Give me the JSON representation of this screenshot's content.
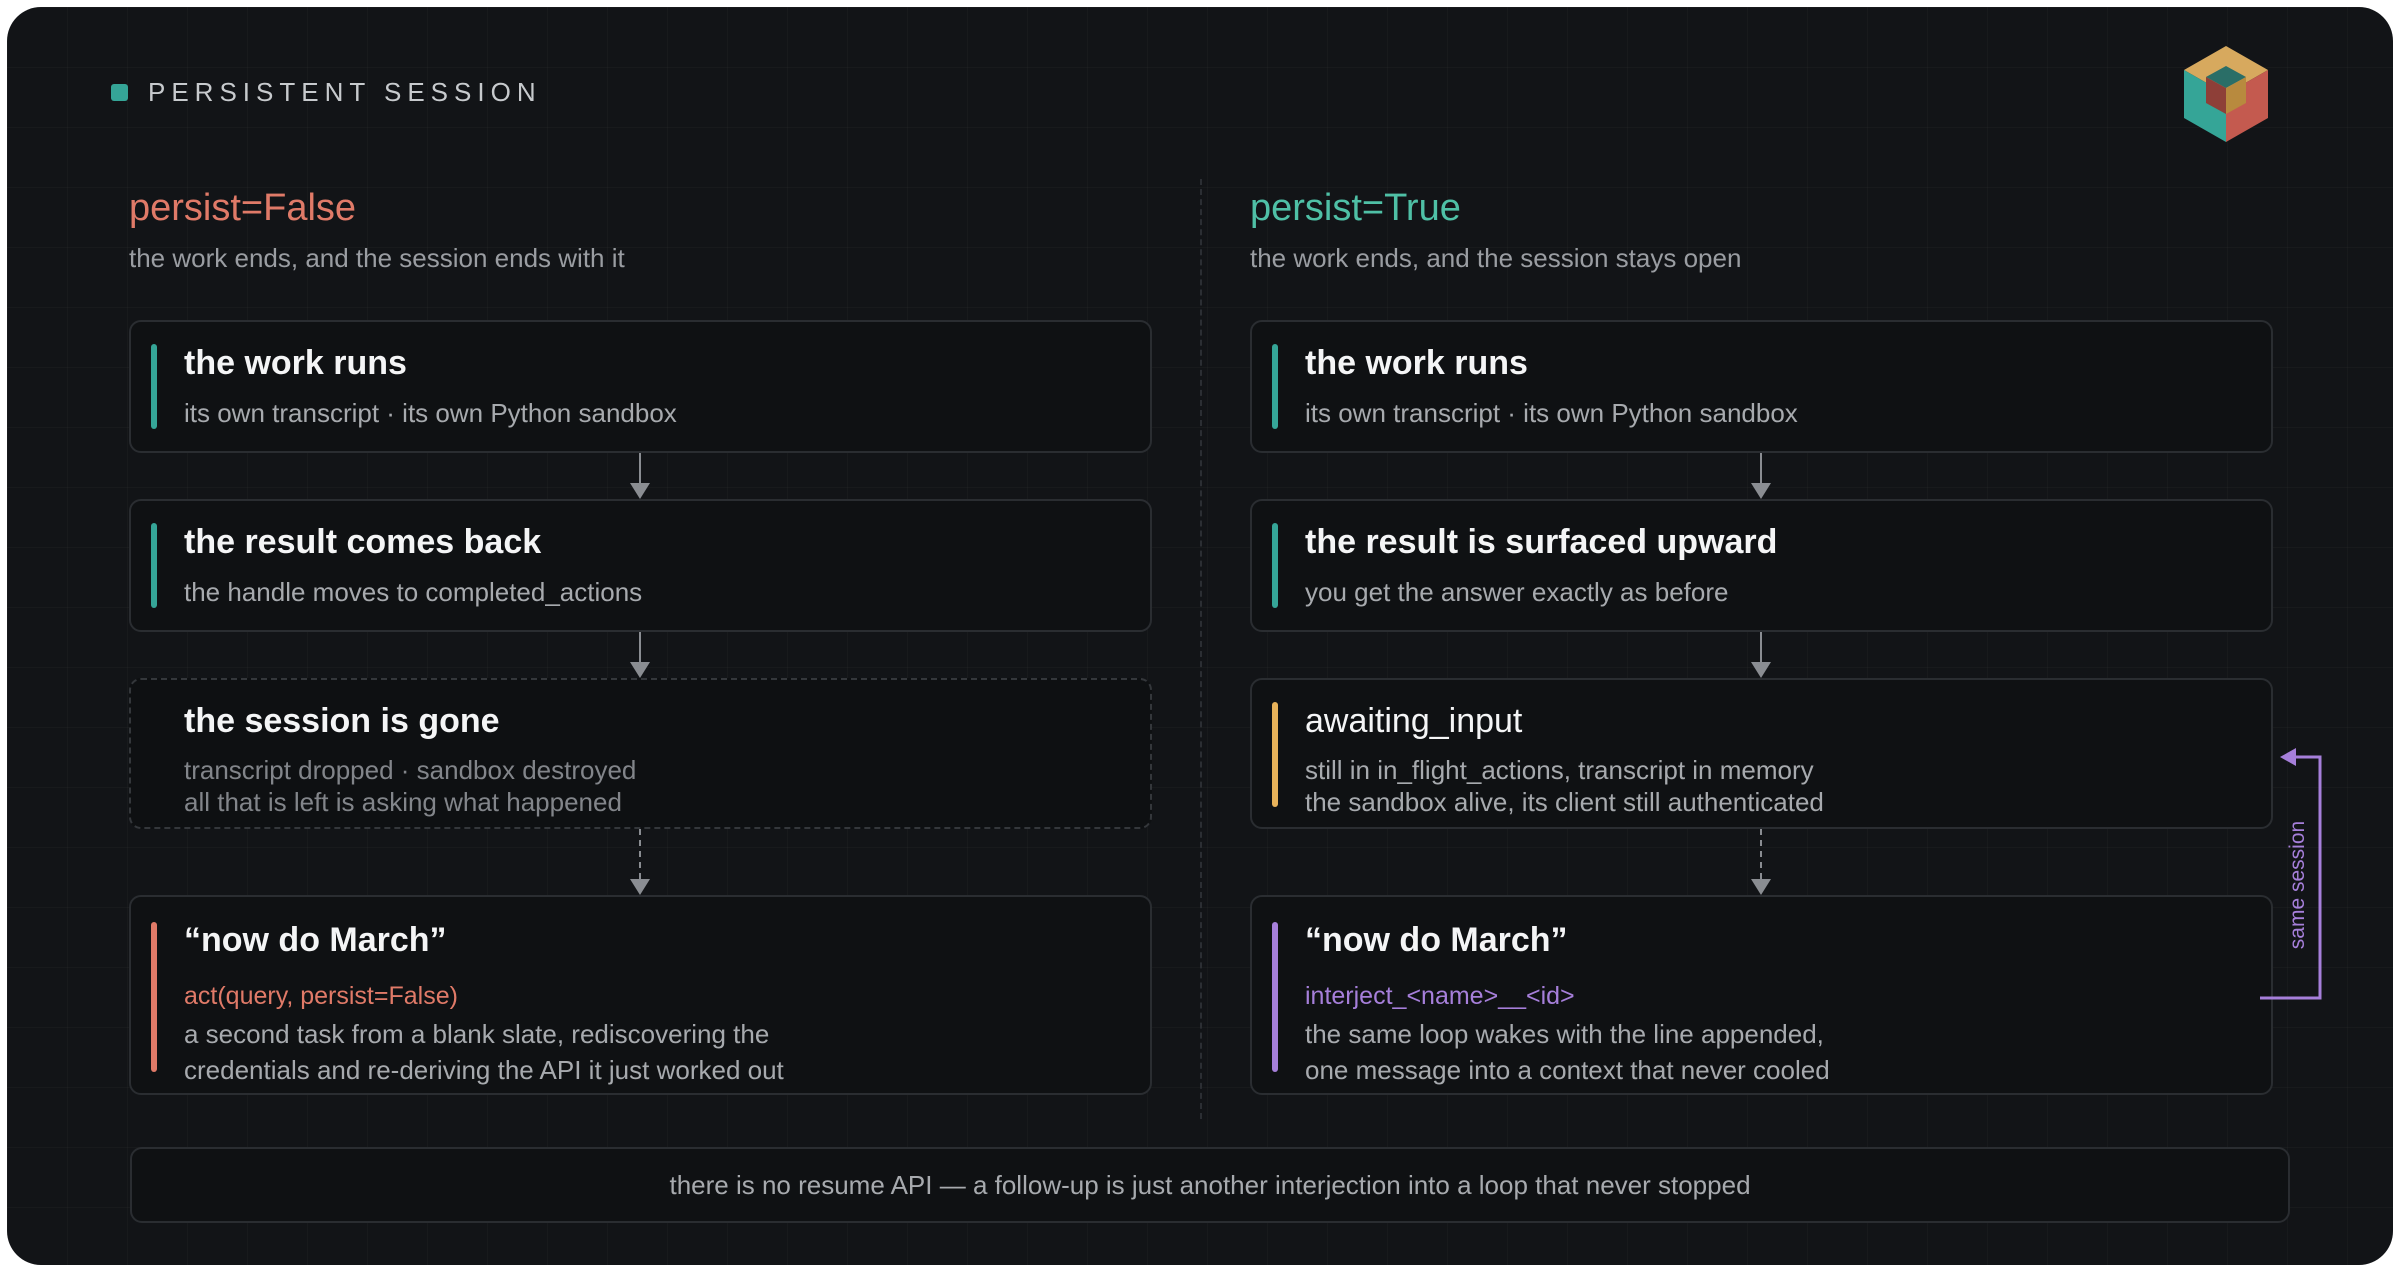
{
  "header": {
    "eyebrow": "PERSISTENT SESSION",
    "logo_icon": "isometric-cube-logo"
  },
  "left": {
    "title": "persist=False",
    "subtitle": "the work ends, and the session ends with it",
    "title_color": "#e07a68",
    "cards": [
      {
        "title": "the work runs",
        "lines": [
          "its own transcript · its own Python sandbox"
        ]
      },
      {
        "title": "the result comes back",
        "lines": [
          "the handle moves to completed_actions"
        ]
      },
      {
        "title": "the session is gone",
        "lines": [
          "transcript dropped · sandbox destroyed",
          "all that is left is asking what happened"
        ]
      },
      {
        "title": "“now do March”",
        "code": "act(query, persist=False)",
        "lines": [
          "a second task from a blank slate, rediscovering the",
          "credentials and re-deriving the API it just worked out"
        ]
      }
    ]
  },
  "right": {
    "title": "persist=True",
    "subtitle": "the work ends, and the session stays open",
    "title_color": "#4fc0a6",
    "cards": [
      {
        "title": "the work runs",
        "lines": [
          "its own transcript · its own Python sandbox"
        ]
      },
      {
        "title": "the result is surfaced upward",
        "lines": [
          "you get the answer exactly as before"
        ]
      },
      {
        "title": "awaiting_input",
        "lines": [
          "still in in_flight_actions, transcript in memory",
          "the sandbox alive, its client still authenticated"
        ]
      },
      {
        "title": "“now do March”",
        "code": "interject_<name>__<id>",
        "lines": [
          "the same loop wakes with the line appended,",
          "one message into a context that never cooled"
        ]
      }
    ]
  },
  "loop_label": "same session",
  "footer": "there is no resume API — a follow-up is just another interjection into a loop that never stopped",
  "colors": {
    "teal": "#35a597",
    "red": "#e07a68",
    "amber": "#e7b25a",
    "purple": "#a67fda",
    "background": "#121417"
  }
}
